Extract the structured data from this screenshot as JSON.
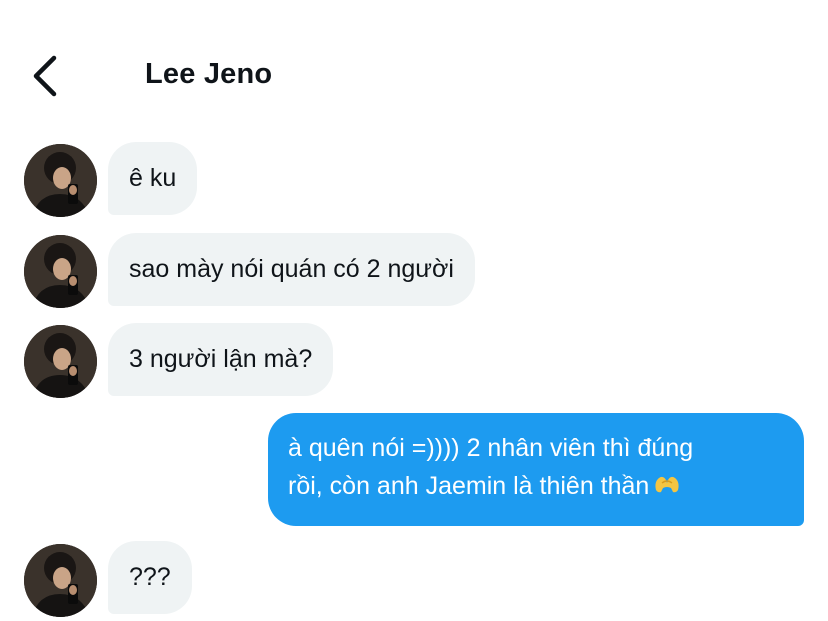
{
  "header": {
    "contact_name": "Lee Jeno"
  },
  "icons": {
    "back": "chevron-left-icon",
    "heart_hands": "heart-hands-emoji"
  },
  "colors": {
    "incoming_bubble": "#eff3f4",
    "outgoing_bubble": "#1d9bf0",
    "text": "#0f1419"
  },
  "messages": [
    {
      "sender": "contact",
      "text": "ê ku"
    },
    {
      "sender": "contact",
      "text": "sao mày nói quán có 2 người"
    },
    {
      "sender": "contact",
      "text": "3 người lận mà?"
    },
    {
      "sender": "me",
      "line1": "à quên nói =)))) 2 nhân viên thì đúng",
      "line2": "rồi, còn anh Jaemin là thiên thần"
    },
    {
      "sender": "contact",
      "text": "???"
    }
  ]
}
